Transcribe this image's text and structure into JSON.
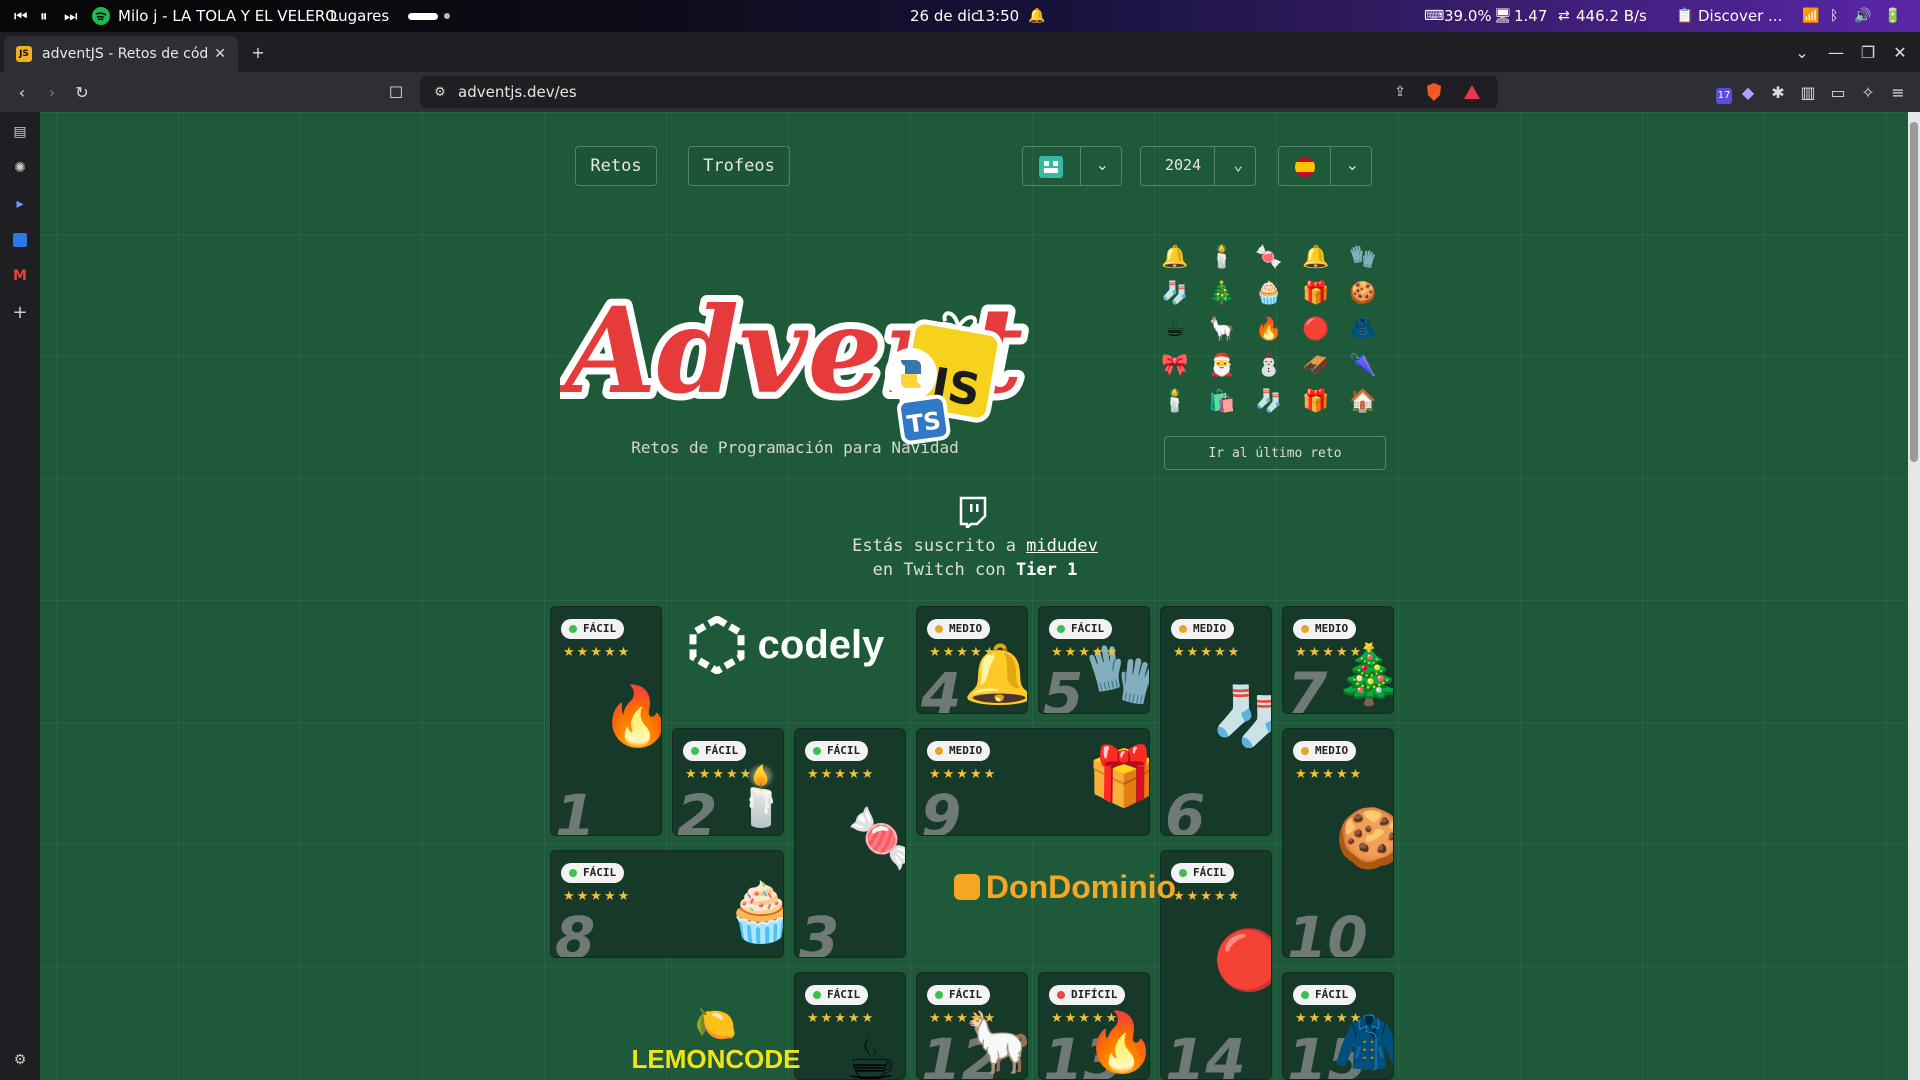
{
  "os_bar": {
    "media_controls": [
      "⏮",
      "⏸",
      "⏭"
    ],
    "now_playing": "Milo j - LA TOLA Y EL VELERO",
    "places": "Lugares",
    "date": "26 de dic",
    "time": "13:50",
    "battery": "39.0%",
    "load": "1.47",
    "net_speed": "446.2 B/s",
    "discover": "Discover ...",
    "icons": [
      "spotify-icon",
      "bell-icon",
      "wifi-icon",
      "bluetooth-icon",
      "volume-icon",
      "battery-icon"
    ]
  },
  "browser": {
    "tab_title": "adventJS - Retos de códi",
    "tab_favicon": "JS",
    "url": "adventjs.dev/es",
    "extension_badge": "17"
  },
  "page": {
    "nav": {
      "retos": "Retos",
      "trofeos": "Trofeos",
      "year": "2024"
    },
    "logo": {
      "word": "Advent",
      "js": "JS",
      "ts": "TS"
    },
    "subtitle": "Retos de Programación para Navidad",
    "stickers": [
      "🔔",
      "🕯️",
      "🍬",
      "🔔",
      "🧤",
      "🧦",
      "🎄",
      "🧁",
      "🎁",
      "🍪",
      "☕",
      "🦙",
      "🔥",
      "🔴",
      "🧥",
      "🎀",
      "🎅",
      "⛄",
      "🛷",
      "🌂",
      "🕯️",
      "🛍️",
      "🧦",
      "🎁",
      "🏠"
    ],
    "last_challenge": "Ir al último reto",
    "subscription": {
      "line1_prefix": "Estás suscrito a ",
      "user": "midudev",
      "line2_prefix": "en Twitch con ",
      "tier": "Tier 1"
    },
    "cards": [
      {
        "day": "1",
        "level": "FÁCIL",
        "stars": "★★★★★",
        "emoji": "🔥"
      },
      {
        "day": "2",
        "level": "FÁCIL",
        "stars": "★★★★★",
        "emoji": "🕯️"
      },
      {
        "day": "3",
        "level": "FÁCIL",
        "stars": "★★★★★",
        "emoji": "🍬"
      },
      {
        "day": "4",
        "level": "MEDIO",
        "stars": "★★★★★",
        "emoji": "🔔"
      },
      {
        "day": "5",
        "level": "FÁCIL",
        "stars": "★★★★★",
        "emoji": "🧤"
      },
      {
        "day": "6",
        "level": "MEDIO",
        "stars": "★★★★★",
        "emoji": "🧦"
      },
      {
        "day": "7",
        "level": "MEDIO",
        "stars": "★★★★★",
        "emoji": "🎄"
      },
      {
        "day": "8",
        "level": "FÁCIL",
        "stars": "★★★★★",
        "emoji": "🧁"
      },
      {
        "day": "9",
        "level": "MEDIO",
        "stars": "★★★★★",
        "emoji": "🎁"
      },
      {
        "day": "10",
        "level": "MEDIO",
        "stars": "★★★★★",
        "emoji": "🍪"
      },
      {
        "day": "12",
        "level": "FÁCIL",
        "stars": "★★★★★",
        "emoji": "🦙"
      },
      {
        "day": "13",
        "level": "DIFÍCIL",
        "stars": "★★★★★",
        "emoji": "🔥"
      },
      {
        "day": "14",
        "level": "FÁCIL",
        "stars": "★★★★★",
        "emoji": "🔴"
      },
      {
        "day": "15",
        "level": "FÁCIL",
        "stars": "★★★★★",
        "emoji": "🧥"
      },
      {
        "day": "",
        "level": "FÁCIL",
        "stars": "★★★★★",
        "emoji": "☕"
      }
    ],
    "sponsors": {
      "codely": "codely",
      "dondominio": "DonDominio",
      "lemoncode": "LEMONCODE"
    },
    "colors": {
      "background": "#1e5a3a",
      "card": "#17392a",
      "easy": "#3fbf4f",
      "medium": "#e5a823",
      "hard": "#e54848",
      "stars": "#f0c23a"
    }
  }
}
